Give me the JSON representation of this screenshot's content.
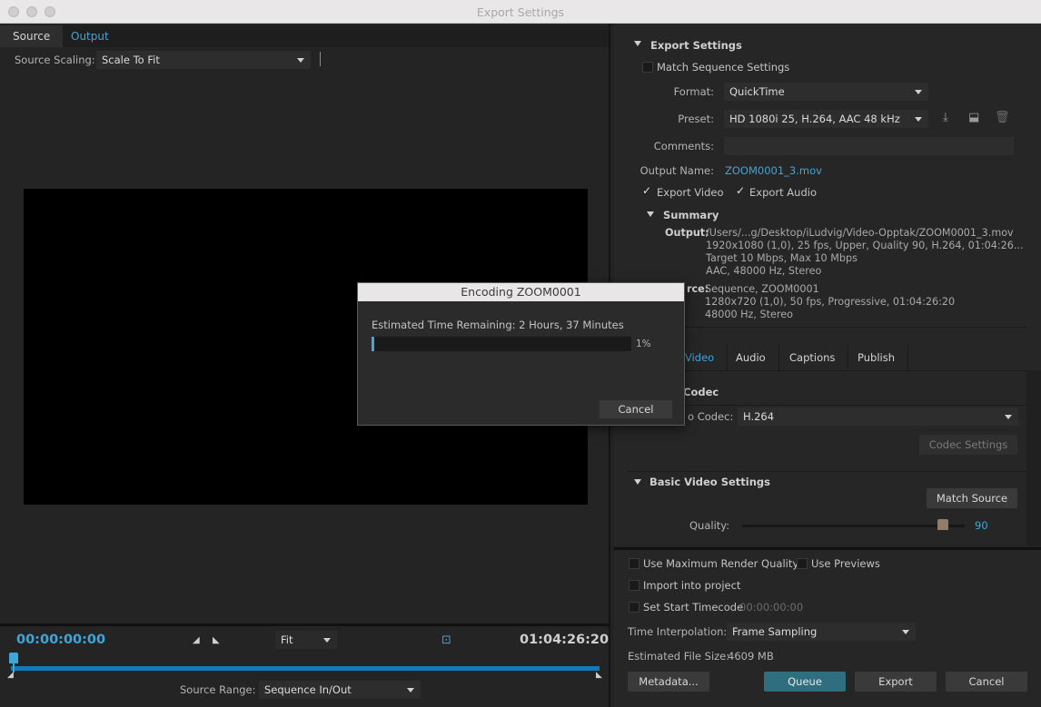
{
  "window": {
    "title": "Export Settings"
  },
  "left": {
    "tabs": [
      "Source",
      "Output"
    ],
    "source_scaling_label": "Source Scaling:",
    "source_scaling_value": "Scale To Fit",
    "timecode_start": "00:00:00:00",
    "timecode_end": "01:04:26:20",
    "zoom": "Fit",
    "source_range_label": "Source Range:",
    "source_range_value": "Sequence In/Out"
  },
  "export_settings": {
    "header": "Export Settings",
    "match_sequence": "Match Sequence Settings",
    "format_label": "Format:",
    "format_value": "QuickTime",
    "preset_label": "Preset:",
    "preset_value": "HD 1080i 25, H.264, AAC 48 kHz",
    "comments_label": "Comments:",
    "output_name_label": "Output Name:",
    "output_name_value": "ZOOM0001_3.mov",
    "export_video": "Export Video",
    "export_audio": "Export Audio",
    "summary_header": "Summary",
    "summary_output_label": "Output:",
    "summary_output_lines": [
      "/Users/...g/Desktop/iLudvig/Video-Opptak/ZOOM0001_3.mov",
      "1920x1080 (1,0), 25 fps, Upper, Quality 90, H.264, 01:04:26...",
      "Target 10 Mbps, Max 10 Mbps",
      "AAC, 48000 Hz, Stereo"
    ],
    "summary_source_label": "rce:",
    "summary_source_lines": [
      "Sequence, ZOOM0001",
      "1280x720 (1,0), 50 fps, Progressive, 01:04:26:20",
      "48000 Hz, Stereo"
    ]
  },
  "settings_tabs": [
    "Video",
    "Audio",
    "Captions",
    "Publish"
  ],
  "video": {
    "codec_header": "Codec",
    "video_codec_label": "o Codec:",
    "video_codec_value": "H.264",
    "codec_settings": "Codec Settings",
    "basic_header": "Basic Video Settings",
    "match_source": "Match Source",
    "quality_label": "Quality:",
    "quality_value": "90",
    "quality_fraction": 0.9
  },
  "bottom": {
    "max_render": "Use Maximum Render Quality",
    "use_previews": "Use Previews",
    "import_project": "Import into project",
    "start_timecode": "Set Start Timecode",
    "start_timecode_value": "00:00:00:00",
    "interp_label": "Time Interpolation:",
    "interp_value": "Frame Sampling",
    "size_label": "Estimated File Size:",
    "size_value": "4609 MB",
    "metadata": "Metadata...",
    "queue": "Queue",
    "export": "Export",
    "cancel": "Cancel"
  },
  "dialog": {
    "title": "Encoding ZOOM0001",
    "remaining": "Estimated Time Remaining: 2 Hours, 37 Minutes",
    "percent": "1%",
    "progress_fraction": 0.01,
    "cancel": "Cancel"
  },
  "colors": {
    "accent": "#3ea6d9",
    "queue": "#2f6e7e",
    "track": "#0e7db3"
  }
}
